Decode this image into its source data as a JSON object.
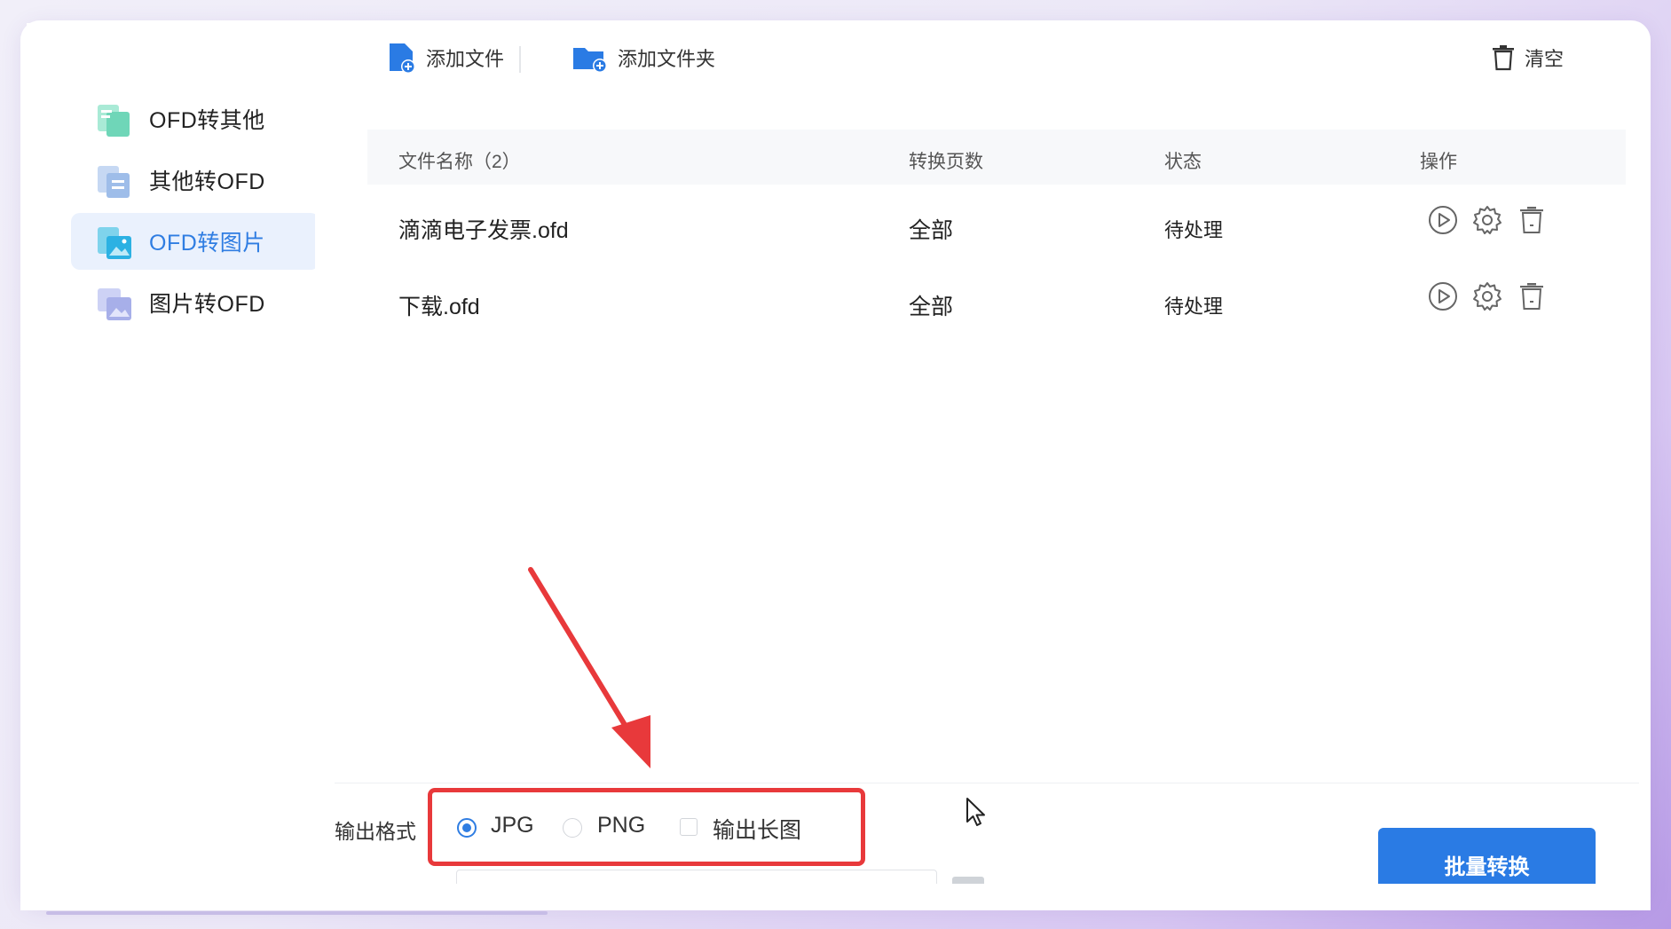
{
  "sidebar": {
    "items": [
      {
        "label": "OFD转其他",
        "icon": "ofd-to-other-icon",
        "active": false
      },
      {
        "label": "其他转OFD",
        "icon": "other-to-ofd-icon",
        "active": false
      },
      {
        "label": "OFD转图片",
        "icon": "ofd-to-image-icon",
        "active": true
      },
      {
        "label": "图片转OFD",
        "icon": "image-to-ofd-icon",
        "active": false
      }
    ]
  },
  "toolbar": {
    "add_file_label": "添加文件",
    "add_folder_label": "添加文件夹",
    "clear_label": "清空"
  },
  "table": {
    "headers": {
      "name": "文件名称（2）",
      "pages": "转换页数",
      "status": "状态",
      "actions": "操作"
    },
    "rows": [
      {
        "name": "滴滴电子发票.ofd",
        "pages": "全部",
        "status": "待处理"
      },
      {
        "name": "下载.ofd",
        "pages": "全部",
        "status": "待处理"
      }
    ]
  },
  "output": {
    "format_label": "输出格式",
    "options": [
      {
        "label": "JPG",
        "selected": true
      },
      {
        "label": "PNG",
        "selected": false
      }
    ],
    "long_image_label": "输出长图",
    "long_image_checked": false
  },
  "actions": {
    "batch_convert_label": "批量转换"
  },
  "colors": {
    "accent": "#2a7be4",
    "active_bg": "#eaf1fd",
    "highlight": "#e8393b"
  }
}
